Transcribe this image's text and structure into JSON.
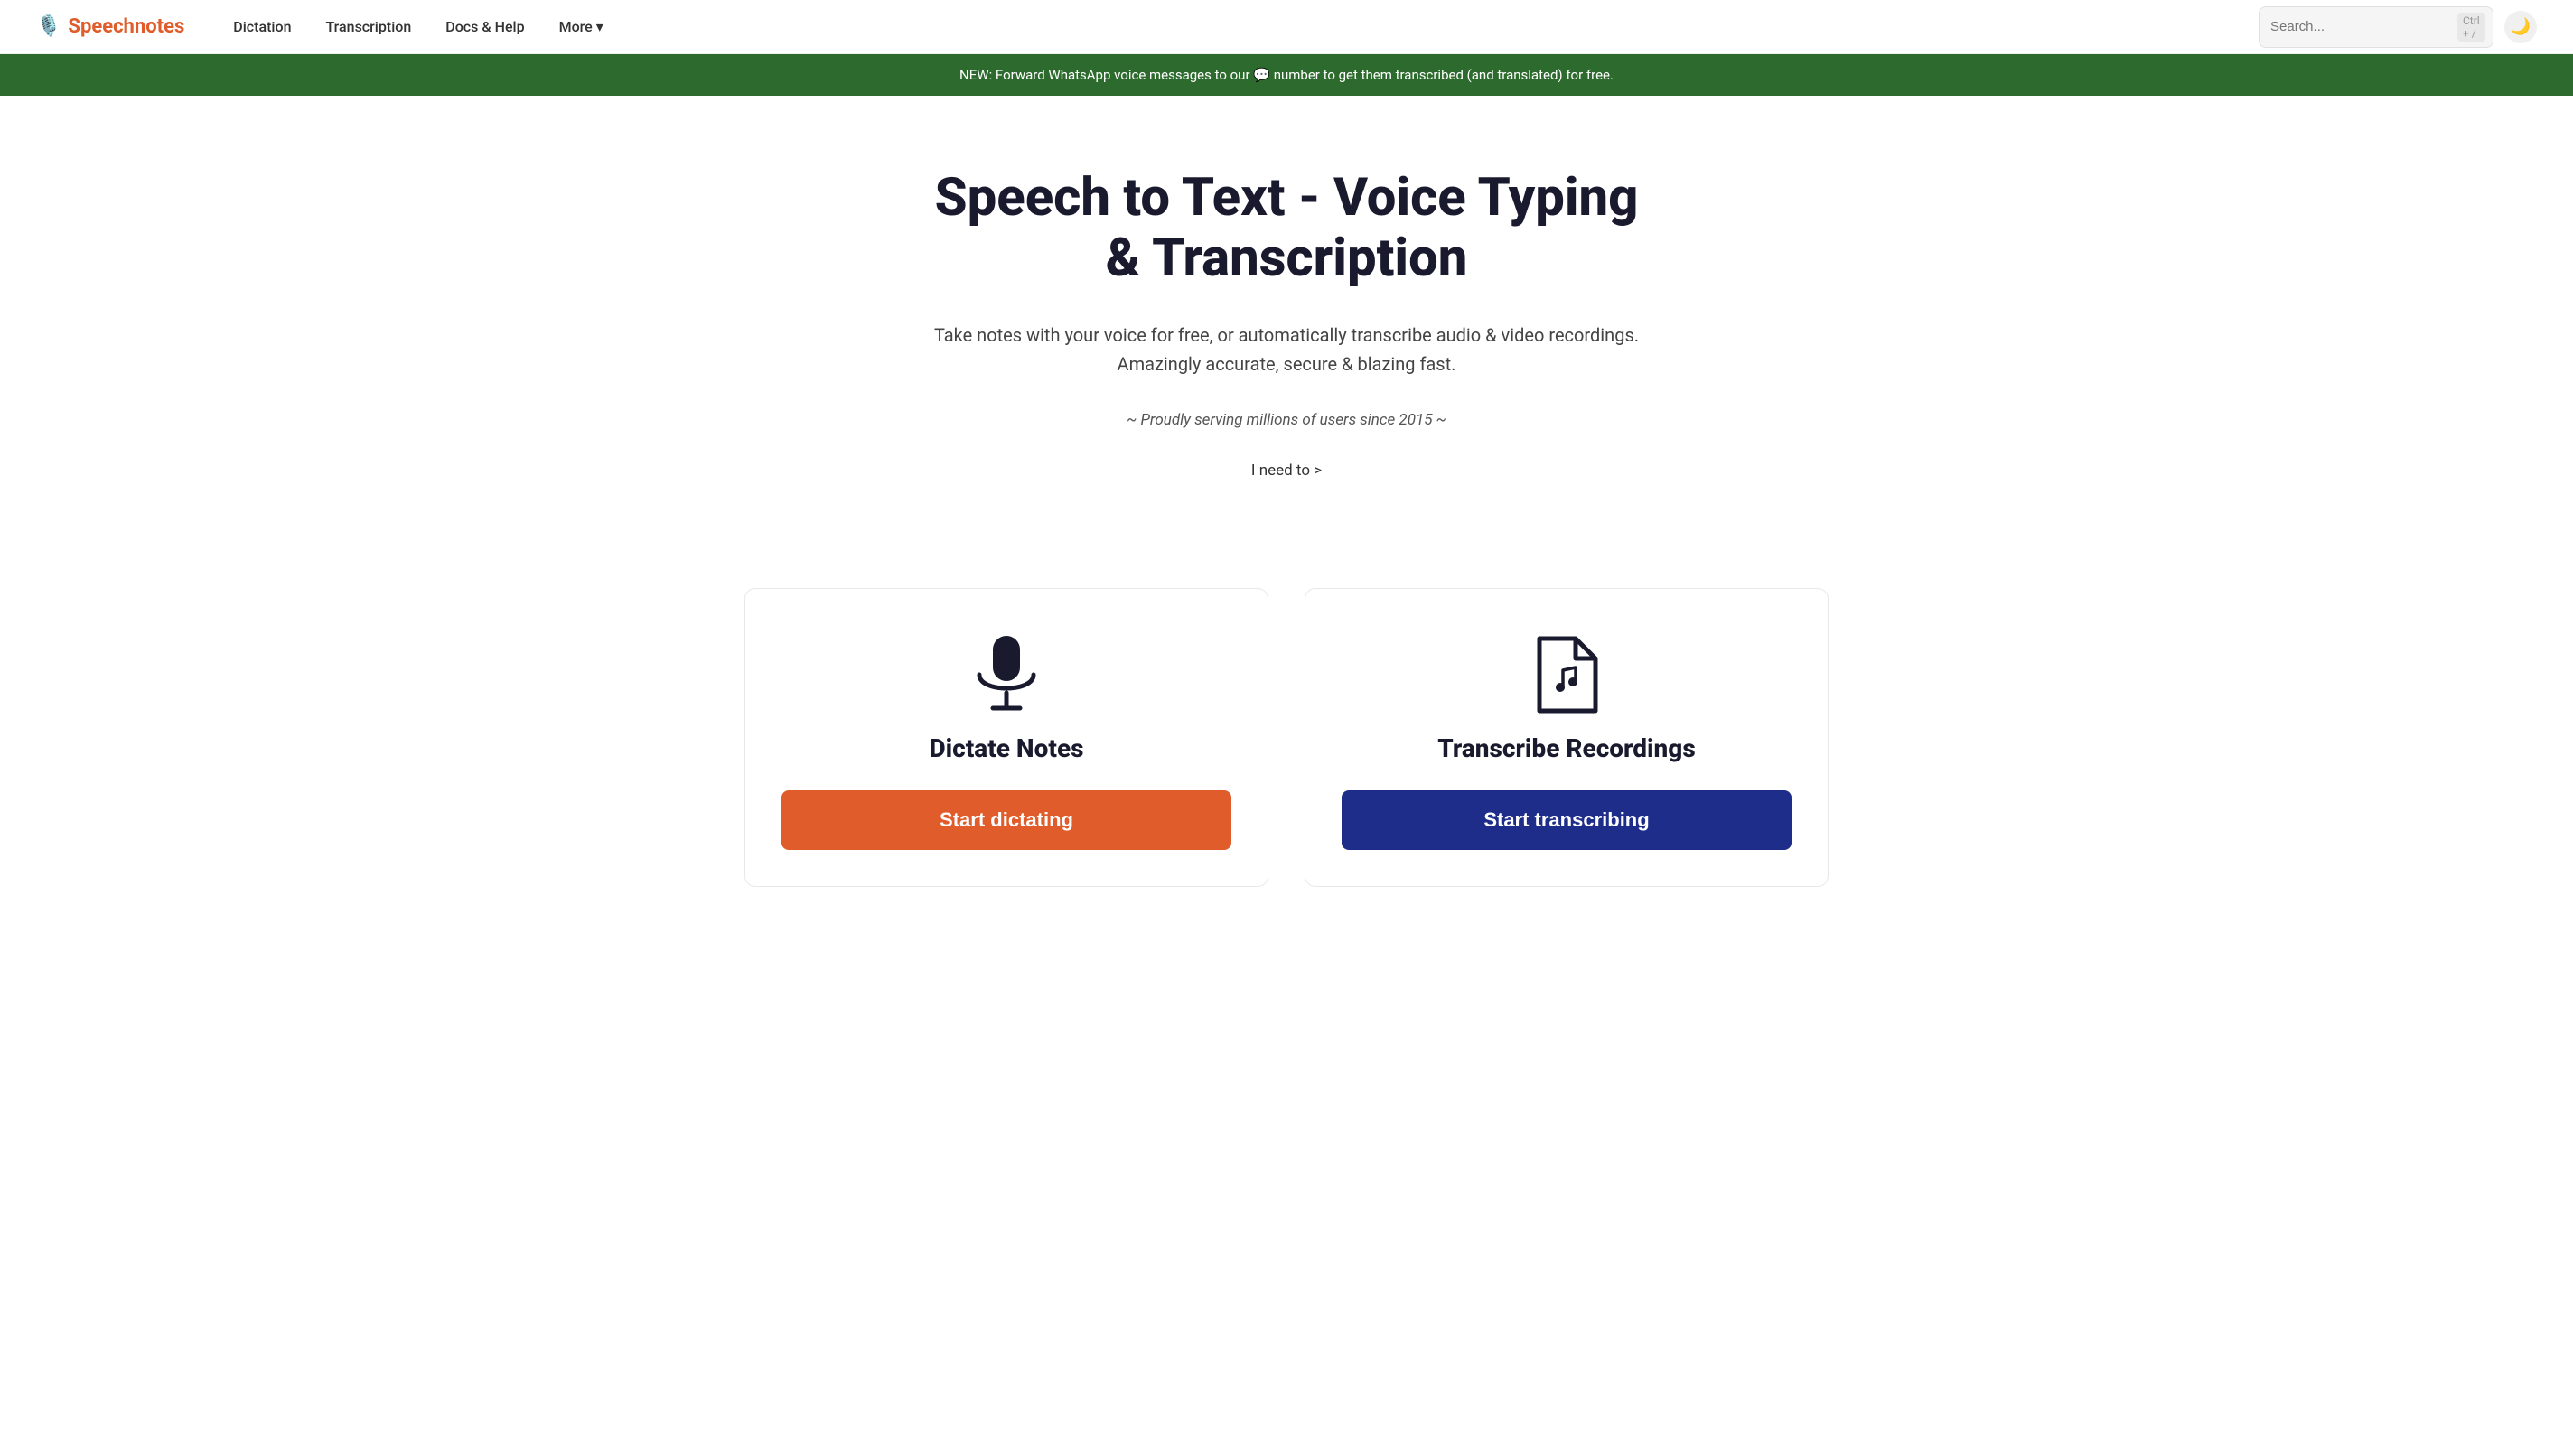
{
  "brand": {
    "icon": "🎙️",
    "name": "Speechnotes"
  },
  "navbar": {
    "links": [
      {
        "id": "dictation",
        "label": "Dictation"
      },
      {
        "id": "transcription",
        "label": "Transcription"
      },
      {
        "id": "docs-help",
        "label": "Docs & Help"
      },
      {
        "id": "more",
        "label": "More ▾"
      }
    ],
    "search": {
      "placeholder": "Search...",
      "shortcut": "Ctrl + /"
    },
    "theme_toggle_icon": "🌙"
  },
  "banner": {
    "text_prefix": "NEW: Forward WhatsApp voice messages to our",
    "text_suffix": "number to get them transcribed (and translated) for free.",
    "whatsapp_icon": "💬"
  },
  "hero": {
    "title": "Speech to Text - Voice Typing & Transcription",
    "subtitle_line1": "Take notes with your voice for free, or automatically transcribe audio & video recordings.",
    "subtitle_line2": "Amazingly accurate, secure & blazing fast.",
    "tagline": "~ Proudly serving millions of users since 2015 ~",
    "cta": "I need to >"
  },
  "cards": [
    {
      "id": "dictate",
      "title": "Dictate Notes",
      "button_label": "Start dictating",
      "type": "dictate"
    },
    {
      "id": "transcribe",
      "title": "Transcribe Recordings",
      "button_label": "Start transcribing",
      "type": "transcribe"
    }
  ]
}
